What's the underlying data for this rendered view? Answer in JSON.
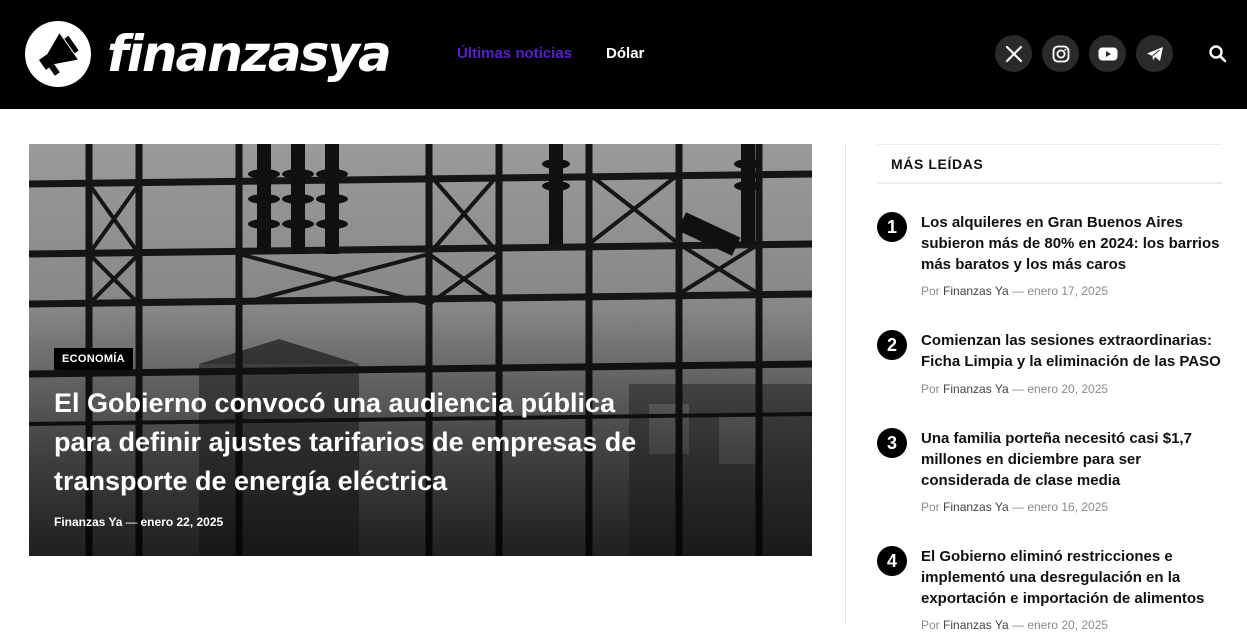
{
  "header": {
    "logo_text": "finanzasya",
    "nav": [
      {
        "label": "Últimas noticias",
        "active": true
      },
      {
        "label": "Dólar",
        "active": false
      }
    ],
    "socials": [
      "x-icon",
      "instagram-icon",
      "youtube-icon",
      "telegram-icon"
    ],
    "search_icon": "search-icon",
    "colors": {
      "background": "#000000",
      "active_nav": "#5a1ed0"
    }
  },
  "hero": {
    "category": "ECONOMÍA",
    "title": "El Gobierno convocó una audiencia pública para definir ajustes tarifarios de empresas de transporte de energía eléctrica",
    "author": "Finanzas Ya",
    "date": "enero 22, 2025"
  },
  "sidebar": {
    "heading": "MÁS LEÍDAS",
    "items": [
      {
        "rank": "1",
        "title": "Los alquileres en Gran Buenos Aires subieron más de 80% en 2024: los barrios más baratos y los más caros",
        "by": "Por",
        "author": "Finanzas Ya",
        "sep": "—",
        "date": "enero 17, 2025"
      },
      {
        "rank": "2",
        "title": "Comienzan las sesiones extraordinarias: Ficha Limpia y la eliminación de las PASO",
        "by": "Por",
        "author": "Finanzas Ya",
        "sep": "—",
        "date": "enero 20, 2025"
      },
      {
        "rank": "3",
        "title": "Una familia porteña necesitó casi $1,7 millones en diciembre para ser considerada de clase media",
        "by": "Por",
        "author": "Finanzas Ya",
        "sep": "—",
        "date": "enero 16, 2025"
      },
      {
        "rank": "4",
        "title": "El Gobierno eliminó restricciones e implementó una desregulación en la exportación e importación de alimentos",
        "by": "Por",
        "author": "Finanzas Ya",
        "sep": "—",
        "date": "enero 20, 2025"
      }
    ]
  }
}
